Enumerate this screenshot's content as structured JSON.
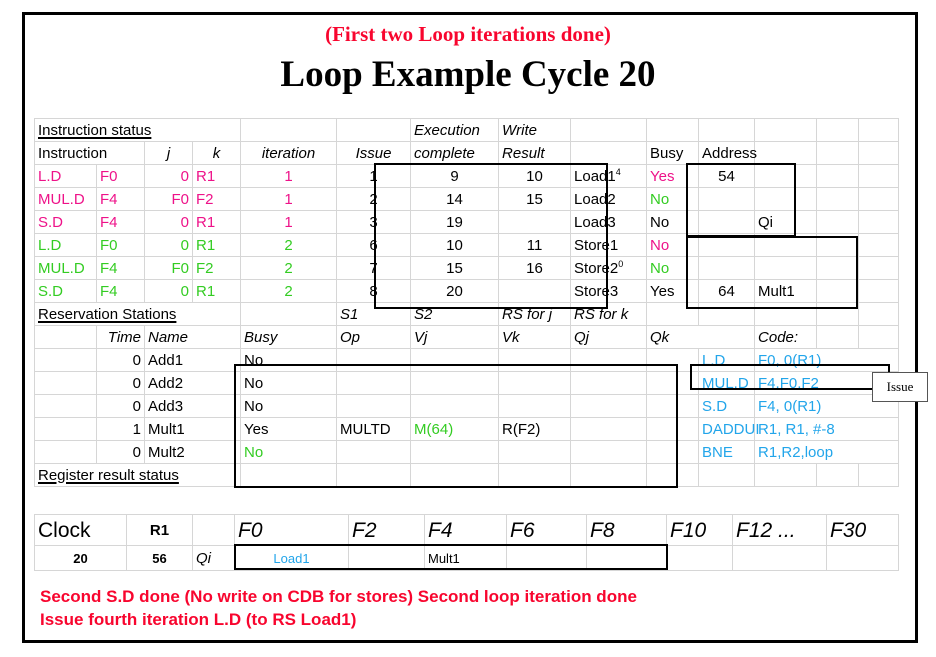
{
  "slide": {
    "subtitle": "(First two Loop iterations done)",
    "title": "Loop Example Cycle 20",
    "callout": "Issue",
    "notes_line1": "Second S.D done  (No write on CDB for stores)  Second loop iteration done",
    "notes_line2": "Issue fourth iteration L.D (to RS Load1)"
  },
  "colors": {
    "red": "#f8052e",
    "pink": "#ee1289",
    "green": "#33cc22",
    "cyan": "#22a5ea",
    "black": "#000000"
  },
  "instruction_status": {
    "section_title": "Instruction status",
    "headers": {
      "instruction": "Instruction",
      "j": "j",
      "k": "k",
      "iteration": "iteration",
      "issue": "Issue",
      "execution": "Execution",
      "write": "Write",
      "complete": "complete",
      "result": "Result"
    },
    "rows": [
      {
        "op": "L.D",
        "dest": "F0",
        "j": "0",
        "k": "R1",
        "iteration": "1",
        "issue": "1",
        "complete": "9",
        "result": "10",
        "color": "pink"
      },
      {
        "op": "MUL.D",
        "dest": "F4",
        "j": "F0",
        "k": "F2",
        "iteration": "1",
        "issue": "2",
        "complete": "14",
        "result": "15",
        "color": "pink"
      },
      {
        "op": "S.D",
        "dest": "F4",
        "j": "0",
        "k": "R1",
        "iteration": "1",
        "issue": "3",
        "complete": "19",
        "result": "",
        "color": "pink"
      },
      {
        "op": "L.D",
        "dest": "F0",
        "j": "0",
        "k": "R1",
        "iteration": "2",
        "issue": "6",
        "complete": "10",
        "result": "11",
        "color": "green"
      },
      {
        "op": "MUL.D",
        "dest": "F4",
        "j": "F0",
        "k": "F2",
        "iteration": "2",
        "issue": "7",
        "complete": "15",
        "result": "16",
        "color": "green"
      },
      {
        "op": "S.D",
        "dest": "F4",
        "j": "0",
        "k": "R1",
        "iteration": "2",
        "issue": "8",
        "complete": "20",
        "result": "",
        "color": "green"
      }
    ]
  },
  "load_store_units": {
    "headers": {
      "busy": "Busy",
      "address": "Address",
      "qi": "Qi"
    },
    "rows": [
      {
        "name": "Load1",
        "sup": "4",
        "busy": "Yes",
        "busy_color": "pink",
        "address": "54",
        "qi": ""
      },
      {
        "name": "Load2",
        "sup": "",
        "busy": "No",
        "busy_color": "green",
        "address": "",
        "qi": ""
      },
      {
        "name": "Load3",
        "sup": "",
        "busy": "No",
        "busy_color": "black",
        "address": "",
        "qi": "Qi"
      },
      {
        "name": "Store1",
        "sup": "",
        "busy": "No",
        "busy_color": "pink",
        "address": "",
        "qi": ""
      },
      {
        "name": "Store2",
        "sup": "0",
        "busy": "No",
        "busy_color": "green",
        "address": "",
        "qi": ""
      },
      {
        "name": "Store3",
        "sup": "",
        "busy": "Yes",
        "busy_color": "black",
        "address": "64",
        "qi": "Mult1"
      }
    ]
  },
  "reservation_stations": {
    "section_title": "Reservation Stations",
    "group_headers": {
      "s1": "S1",
      "s2": "S2",
      "rs_for_j": "RS for j",
      "rs_for_k": "RS for k"
    },
    "headers": {
      "time": "Time",
      "name": "Name",
      "busy": "Busy",
      "op": "Op",
      "vj": "Vj",
      "vk": "Vk",
      "qj": "Qj",
      "qk": "Qk"
    },
    "rows": [
      {
        "time": "0",
        "name": "Add1",
        "busy": "No",
        "busy_color": "black",
        "op": "",
        "vj": "",
        "vj_color": "black",
        "vk": "",
        "qj": "",
        "qk": ""
      },
      {
        "time": "0",
        "name": "Add2",
        "busy": "No",
        "busy_color": "black",
        "op": "",
        "vj": "",
        "vj_color": "black",
        "vk": "",
        "qj": "",
        "qk": ""
      },
      {
        "time": "0",
        "name": "Add3",
        "busy": "No",
        "busy_color": "black",
        "op": "",
        "vj": "",
        "vj_color": "black",
        "vk": "",
        "qj": "",
        "qk": ""
      },
      {
        "time": "1",
        "name": "Mult1",
        "busy": "Yes",
        "busy_color": "black",
        "op": "MULTD",
        "vj": "M(64)",
        "vj_color": "green",
        "vk": "R(F2)",
        "qj": "",
        "qk": ""
      },
      {
        "time": "0",
        "name": "Mult2",
        "busy": "No",
        "busy_color": "green",
        "op": "",
        "vj": "",
        "vj_color": "black",
        "vk": "",
        "qj": "",
        "qk": ""
      }
    ]
  },
  "code": {
    "label": "Code:",
    "lines": [
      {
        "op": "L.D",
        "args": "F0, 0(R1)"
      },
      {
        "op": "MUL.D",
        "args": "F4,F0,F2"
      },
      {
        "op": "S.D",
        "args": "F4, 0(R1)"
      },
      {
        "op": "DADDUI",
        "args": "R1, R1, #-8"
      },
      {
        "op": "BNE",
        "args": "R1,R2,loop"
      }
    ]
  },
  "register_result_status": {
    "section_title": "Register result status",
    "clock_label": "Clock",
    "r1_label": "R1",
    "qi_label": "Qi",
    "clock_value": "20",
    "r1_value": "56",
    "registers": [
      "F0",
      "F2",
      "F4",
      "F6",
      "F8",
      "F10",
      "F12 ...",
      "F30"
    ],
    "values": [
      {
        "reg": "F0",
        "val": "Load1",
        "color": "cyan"
      },
      {
        "reg": "F2",
        "val": "",
        "color": "black"
      },
      {
        "reg": "F4",
        "val": "Mult1",
        "color": "black"
      },
      {
        "reg": "F6",
        "val": "",
        "color": "black"
      },
      {
        "reg": "F8",
        "val": "",
        "color": "black"
      },
      {
        "reg": "F10",
        "val": "",
        "color": "black"
      },
      {
        "reg": "F12 ...",
        "val": "",
        "color": "black"
      },
      {
        "reg": "F30",
        "val": "",
        "color": "black"
      }
    ]
  }
}
